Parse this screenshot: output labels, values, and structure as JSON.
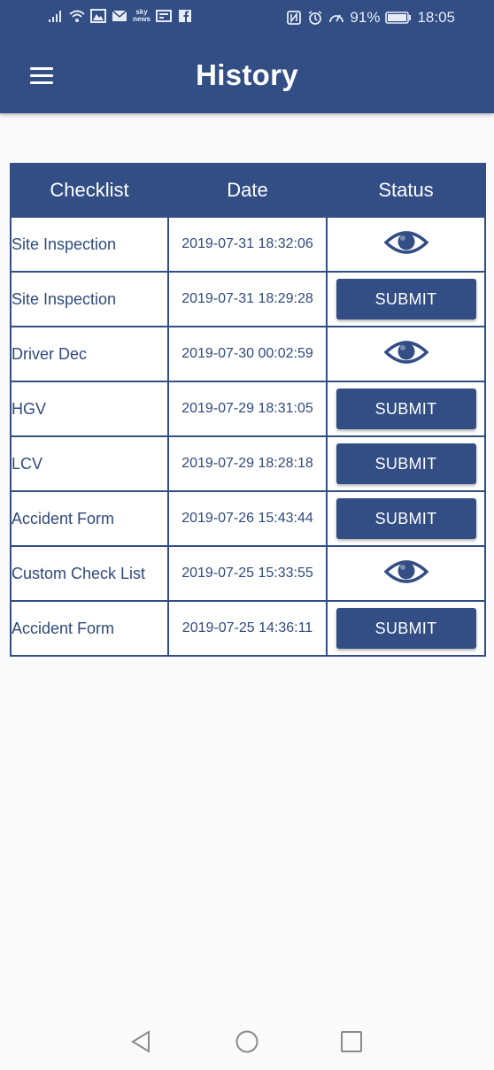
{
  "status_bar": {
    "sky_top": "sky",
    "sky_bottom": "news",
    "battery": "91%",
    "time": "18:05"
  },
  "header": {
    "title": "History"
  },
  "table": {
    "columns": [
      "Checklist",
      "Date",
      "Status"
    ],
    "rows": [
      {
        "name": "Site Inspection",
        "date": "2019-07-31 18:32:06",
        "status": "view"
      },
      {
        "name": "Site Inspection",
        "date": "2019-07-31 18:29:28",
        "status": "submit"
      },
      {
        "name": "Driver Dec",
        "date": "2019-07-30 00:02:59",
        "status": "view"
      },
      {
        "name": "HGV",
        "date": "2019-07-29 18:31:05",
        "status": "submit"
      },
      {
        "name": "LCV",
        "date": "2019-07-29 18:28:18",
        "status": "submit"
      },
      {
        "name": "Accident Form",
        "date": "2019-07-26 15:43:44",
        "status": "submit"
      },
      {
        "name": "Custom Check List",
        "date": "2019-07-25 15:33:55",
        "status": "view"
      },
      {
        "name": "Accident Form",
        "date": "2019-07-25 14:36:11",
        "status": "submit"
      }
    ],
    "submit_label": "SUBMIT",
    "view_icon": "eye-icon"
  },
  "colors": {
    "primary": "#324e85",
    "text": "#2f4a7c",
    "background": "#fafafa"
  }
}
